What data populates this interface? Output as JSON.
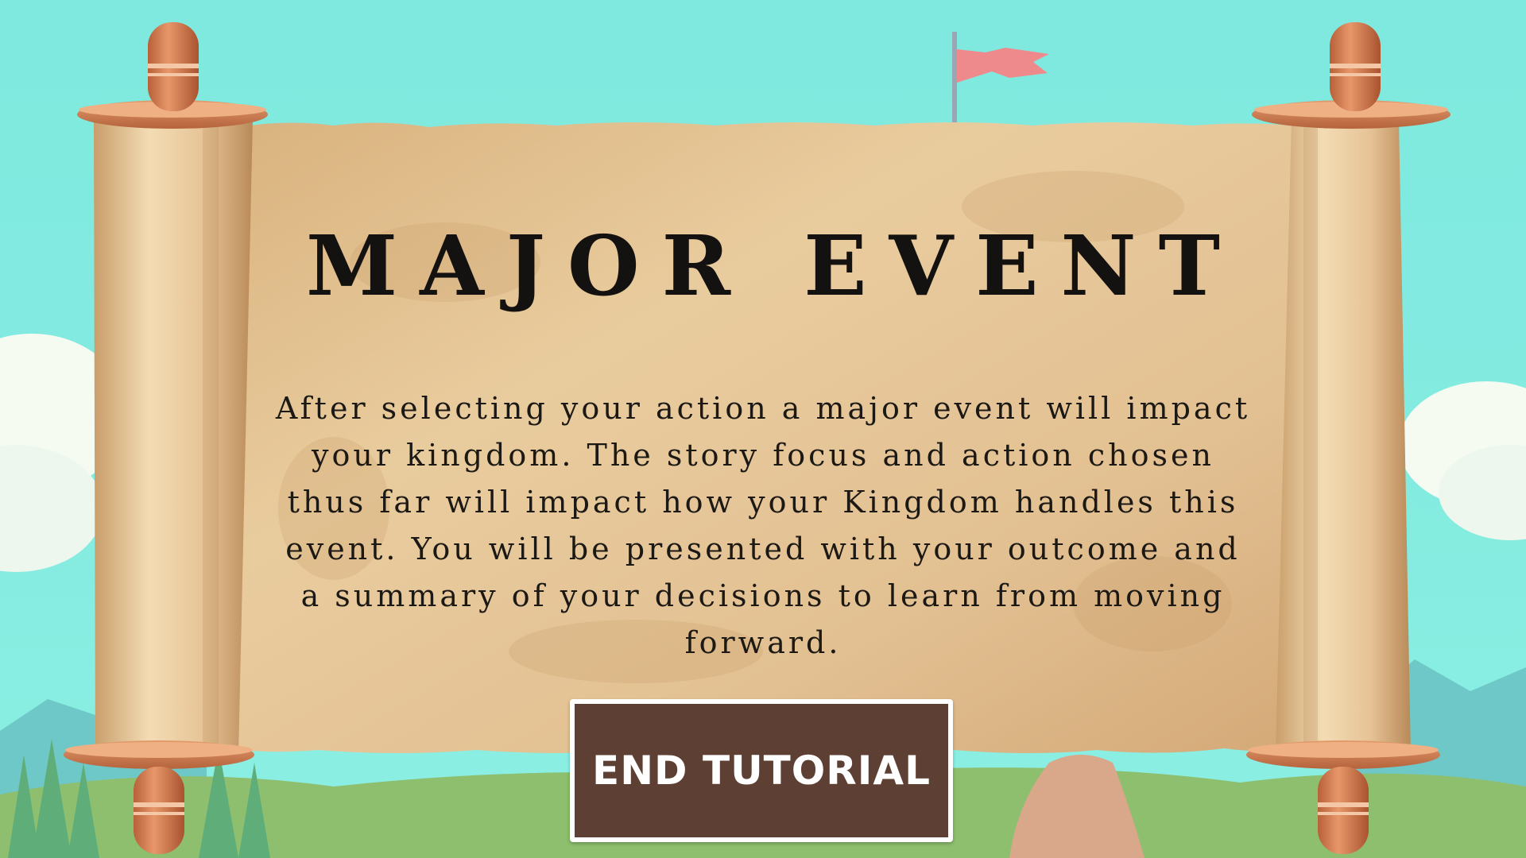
{
  "dialog": {
    "title": "MAJOR EVENT",
    "body": "After selecting your action a major event will impact your kingdom. The story focus and action chosen thus far will impact how your Kingdom handles this event. You will be presented with your outcome and a summary of your decisions to learn from moving forward.",
    "button_label": "END TUTORIAL"
  },
  "colors": {
    "sky": "#7fe9df",
    "parchment": "#e8c89a",
    "scroll_rod": "#c8744a",
    "button_bg": "#5d4033",
    "button_border": "#ffffff",
    "title_text": "#141210",
    "flag": "#ef8a8c"
  },
  "icons": {
    "flag": "castle-flag-icon"
  }
}
